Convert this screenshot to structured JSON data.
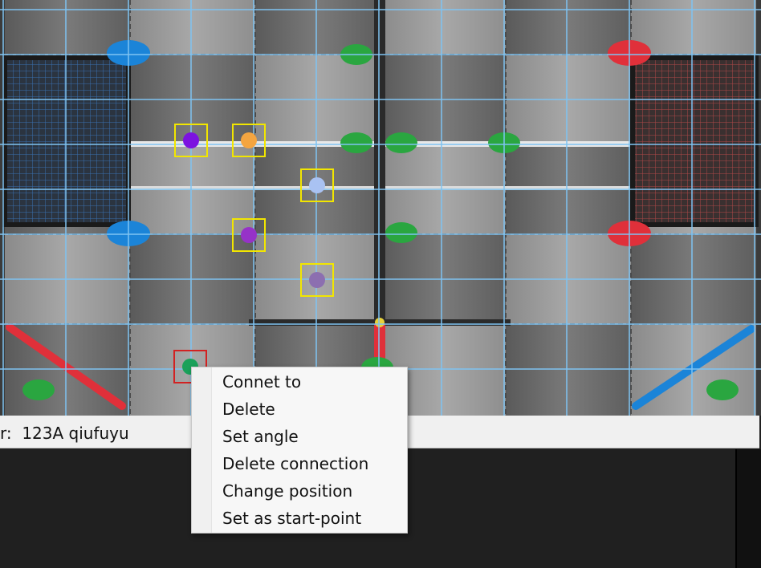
{
  "status_bar": {
    "text": "r:  123A qiufuyu"
  },
  "context_menu": {
    "items": [
      {
        "label": "Connet to"
      },
      {
        "label": "Delete"
      },
      {
        "label": "Set angle"
      },
      {
        "label": "Delete connection"
      },
      {
        "label": "Change position"
      },
      {
        "label": "Set as start-point"
      }
    ]
  },
  "field": {
    "grid_color": "#7fc3f2",
    "selection_color": "#f2e600",
    "active_selection_color": "#d22222",
    "waypoints": [
      {
        "color": "#7c12e0",
        "selected": true
      },
      {
        "color": "#f4a540",
        "selected": true
      },
      {
        "color": "#a9c2f2",
        "selected": true
      },
      {
        "color": "#9632c8",
        "selected": true
      },
      {
        "color": "#8c6fb0",
        "selected": true
      },
      {
        "color": "#1aa15a",
        "selected": false,
        "active": true
      }
    ],
    "team_colors": {
      "blue": "#1b84d8",
      "red": "#e0303a",
      "green": "#2aa640"
    }
  }
}
